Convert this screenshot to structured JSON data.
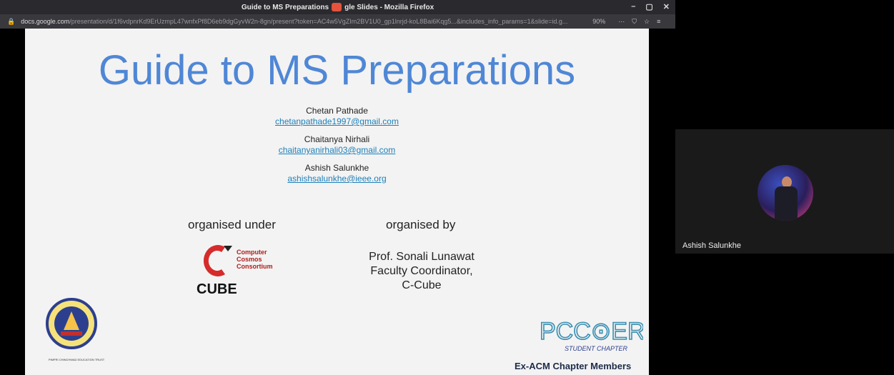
{
  "browser": {
    "title_prefix": "Guide to MS Preparations",
    "title_suffix": "gle Slides - Mozilla Firefox",
    "url_host": "docs.google.com",
    "url_rest": "/presentation/d/1f6vdpnrKd9ErUzmpL47wnfxPf8D6eb9dgGyvW2n-8gn/present?token=AC4w5VgZIm2BV1U0_gp1lnrjd-koL8Bai6Kqg5...&includes_info_params=1&slide=id.g...",
    "zoom": "90%",
    "window_controls": [
      "–",
      "▢",
      "✕"
    ],
    "toolbar_icons": [
      "⋯",
      "⛉",
      "☆",
      "≡"
    ]
  },
  "slide": {
    "title": "Guide to MS Preparations",
    "presenters": [
      {
        "name": "Chetan Pathade",
        "email": "chetanpathade1997@gmail.com"
      },
      {
        "name": "Chaitanya Nirhali",
        "email": "chaitanyanirhali03@gmail.com"
      },
      {
        "name": "Ashish Salunkhe",
        "email": "ashishsalunkhe@ieee.org"
      }
    ],
    "organised_under": "organised under",
    "organised_by": "organised by",
    "coordinator_name": "Prof. Sonali Lunawat",
    "coordinator_role": "Faculty Coordinator,",
    "coordinator_org": "C-Cube",
    "cube_label": "CUBE",
    "cube_name_lines": [
      "Computer",
      "Cosmos",
      "Consortium"
    ],
    "pict_caption": "PIMPRI CHINCHWAD EDUCATION TRUST",
    "footer_right": "Ex-ACM Chapter Members",
    "pccoer_text": "STUDENT CHAPTER"
  },
  "webcam": {
    "participant_name": "Ashish Salunkhe"
  },
  "colors": {
    "title_blue": "#4f87d6",
    "link_blue": "#1e7fb8",
    "cube_red": "#d62b2b"
  }
}
